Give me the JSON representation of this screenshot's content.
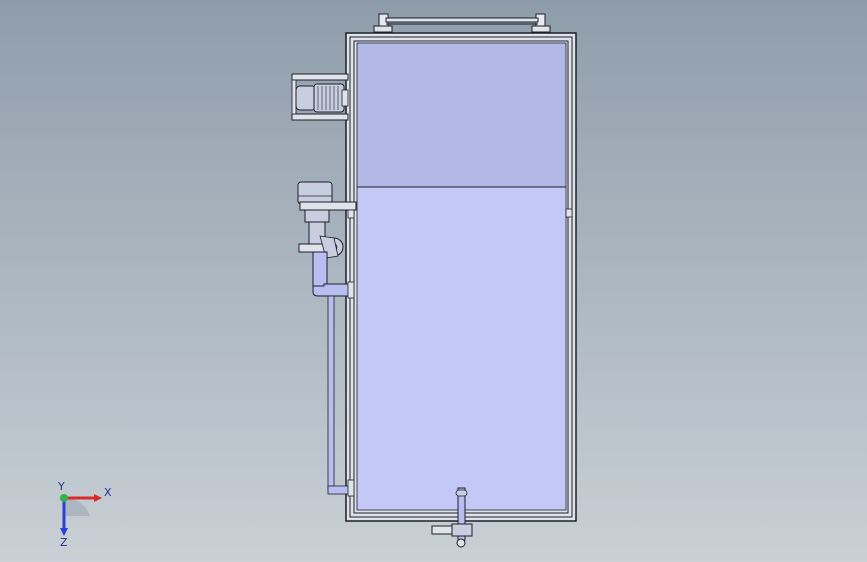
{
  "viewport": {
    "colors": {
      "background_top": "#8f9dab",
      "background_bottom": "#c9d0d6",
      "outline": "#1d1f2a",
      "frame": "#dfe3ea",
      "tank_upper_fill": "#b3b9e6",
      "tank_lower_fill": "#c3c8f7",
      "motor": "#c9cde0",
      "pipe": "#b8beef"
    }
  },
  "triad": {
    "x_label": "X",
    "y_label": "Y",
    "z_label": "Z",
    "colors": {
      "x": "#d92b2b",
      "y": "#2fb34a",
      "z": "#2b3fd9"
    }
  }
}
